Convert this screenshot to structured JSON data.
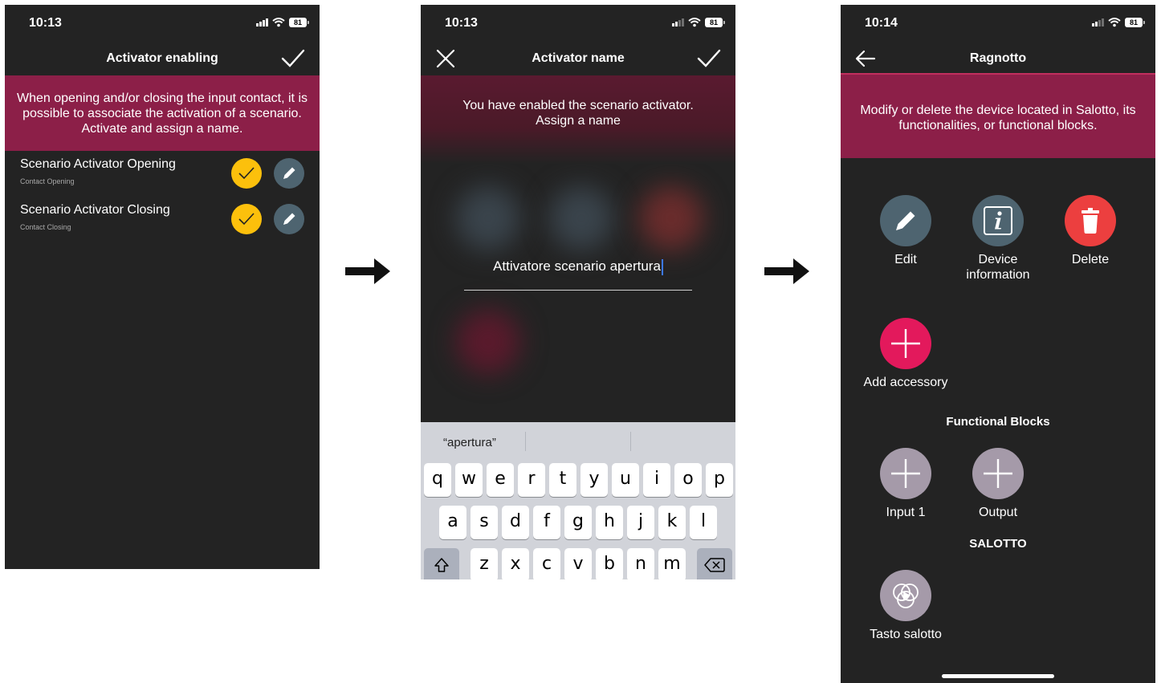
{
  "screen1": {
    "time": "10:13",
    "battery": "81",
    "title": "Activator enabling",
    "banner": "When opening and/or closing the input contact, it is possible to associate the activation of a scenario. Activate and assign a name.",
    "items": [
      {
        "title": "Scenario Activator Opening",
        "subtitle": "Contact Opening"
      },
      {
        "title": "Scenario Activator Closing",
        "subtitle": "Contact Closing"
      }
    ]
  },
  "screen2": {
    "time": "10:13",
    "battery": "81",
    "title": "Activator name",
    "banner": "You have enabled the scenario activator. Assign a name",
    "input_value": "Attivatore scenario apertura",
    "suggestion": "“apertura”",
    "keyboard": {
      "row1": [
        "q",
        "w",
        "e",
        "r",
        "t",
        "y",
        "u",
        "i",
        "o",
        "p"
      ],
      "row2": [
        "a",
        "s",
        "d",
        "f",
        "g",
        "h",
        "j",
        "k",
        "l"
      ],
      "row3": [
        "z",
        "x",
        "c",
        "v",
        "b",
        "n",
        "m"
      ]
    }
  },
  "screen3": {
    "time": "10:14",
    "battery": "81",
    "title": "Ragnotto",
    "banner": "Modify or delete the device located in Salotto, its functionalities, or functional blocks.",
    "actions": {
      "edit": "Edit",
      "info": "Device information",
      "delete": "Delete",
      "add_accessory": "Add accessory"
    },
    "functional_blocks_title": "Functional Blocks",
    "blocks": {
      "input": "Input 1",
      "output": "Output"
    },
    "room_title": "SALOTTO",
    "scene": "Tasto salotto"
  },
  "colors": {
    "background": "#232323",
    "banner": "#8c1f48",
    "yellow": "#fcc00c",
    "slate": "#4e6470",
    "delete_red": "#ec3f3f",
    "add_pink": "#e3195c",
    "block_grey": "#a59aa9"
  }
}
